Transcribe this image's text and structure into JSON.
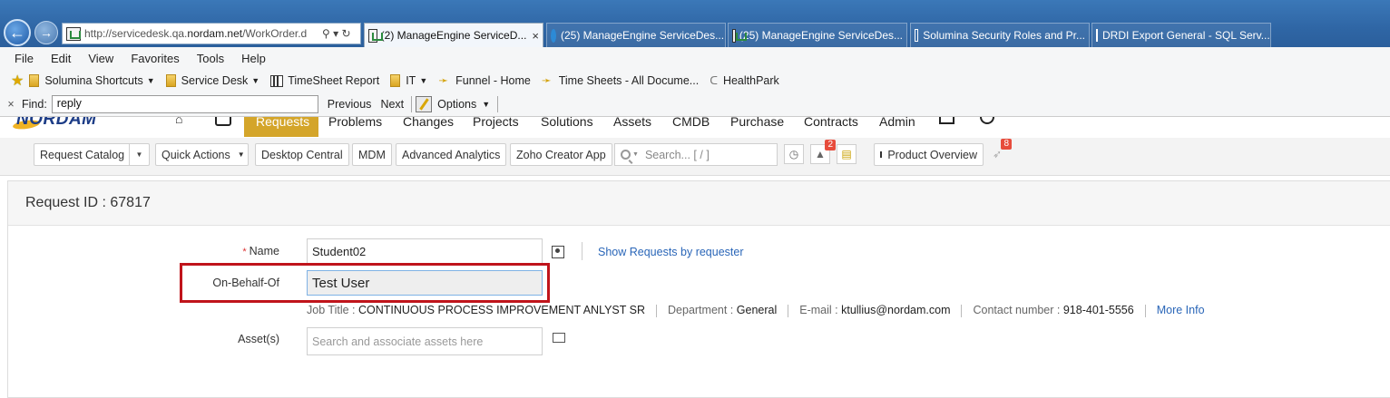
{
  "browser": {
    "address_url_pre": "http://servicedesk.qa.",
    "address_url_host": "nordam.net",
    "address_url_post": "/WorkOrder.d",
    "address_controls": "⚲ ▾ ↻",
    "tabs": [
      {
        "label": "(2) ManageEngine ServiceD...",
        "close": "×"
      },
      {
        "label": "(25) ManageEngine ServiceDes..."
      },
      {
        "label": "(25) ManageEngine ServiceDes..."
      },
      {
        "label": "Solumina Security Roles and Pr..."
      },
      {
        "label": "DRDI Export General - SQL Serv..."
      }
    ],
    "menu": [
      "File",
      "Edit",
      "View",
      "Favorites",
      "Tools",
      "Help"
    ],
    "favorites": [
      {
        "label": "Solumina Shortcuts",
        "icon": "folder-icon",
        "dropdown": true
      },
      {
        "label": "Service Desk",
        "icon": "folder-icon",
        "dropdown": true
      },
      {
        "label": "TimeSheet Report",
        "icon": "report-icon",
        "dropdown": false
      },
      {
        "label": "IT",
        "icon": "folder-icon",
        "dropdown": true
      },
      {
        "label": "Funnel - Home",
        "icon": "sharepoint-icon",
        "dropdown": false
      },
      {
        "label": "Time Sheets - All Docume...",
        "icon": "sharepoint-icon",
        "dropdown": false
      },
      {
        "label": "HealthPark",
        "icon": "c-icon",
        "dropdown": false
      }
    ],
    "find": {
      "close": "×",
      "label": "Find:",
      "value": "reply",
      "previous": "Previous",
      "next": "Next",
      "options": "Options"
    }
  },
  "app": {
    "logo": "NORDAM",
    "nav_tabs": [
      "Requests",
      "Problems",
      "Changes",
      "Projects",
      "Solutions",
      "Assets",
      "CMDB",
      "Purchase",
      "Contracts",
      "Admin"
    ],
    "toolbar": {
      "request_catalog": "Request Catalog",
      "quick_actions": "Quick Actions",
      "desktop_central": "Desktop Central",
      "mdm": "MDM",
      "advanced_analytics": "Advanced Analytics",
      "zoho_creator": "Zoho Creator App",
      "search_placeholder": "Search... [ / ]",
      "notifications_badge": "2",
      "product_overview": "Product Overview",
      "rocket_badge": "8"
    }
  },
  "form": {
    "request_id_label": "Request ID : 67817",
    "name_label": "Name",
    "name_required": "*",
    "name_value": "Student02",
    "show_requests_link": "Show Requests by requester",
    "on_behalf_label": "On-Behalf-Of",
    "on_behalf_value": "Test User",
    "job_title_label": "Job Title :",
    "job_title_value": "CONTINUOUS PROCESS IMPROVEMENT ANLYST SR",
    "department_label": "Department :",
    "department_value": "General",
    "email_label": "E-mail :",
    "email_value": "ktullius@nordam.com",
    "contact_label": "Contact number :",
    "contact_value": "918-401-5556",
    "more_info": "More Info",
    "assets_label": "Asset(s)",
    "assets_placeholder": "Search and associate assets here"
  },
  "colors": {
    "titlebar": "#2f66a5",
    "active_nav_tab": "#d4a52a",
    "highlight_border": "#c0141b",
    "link": "#2a66b8"
  }
}
